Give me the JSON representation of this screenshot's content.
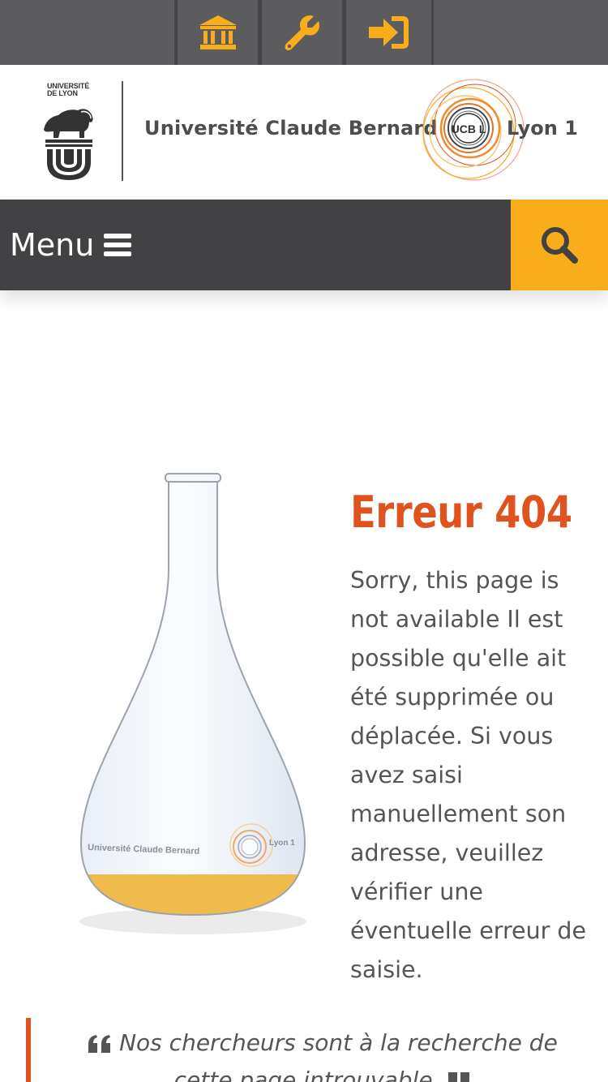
{
  "topbar": {
    "buttons": [
      {
        "icon": "institution-icon",
        "color": "#f9ad1b"
      },
      {
        "icon": "wrench-icon",
        "color": "#f9ad1b"
      },
      {
        "icon": "sign-in-icon",
        "color": "#f9ad1b"
      }
    ]
  },
  "header": {
    "ul_logo_text": "UNIVERSITÉ DE LYON",
    "ucbl_name": "Université Claude Bernard",
    "ucbl_city": "Lyon 1",
    "ring_monogram": "UCB L"
  },
  "menubar": {
    "menu_label": "Menu",
    "search_icon": "search-icon",
    "accent": "#f9ad1b"
  },
  "error": {
    "title": "Erreur 404",
    "message": "Sorry, this page is not available Il est possible qu'elle ait été supprimée ou déplacée. Si vous avez saisi manuellement son adresse, veuillez vérifier une éventuelle erreur de saisie.",
    "title_color": "#e0531e"
  },
  "flask": {
    "label": "Université Claude Bernard",
    "label_city": "Lyon 1",
    "liquid_color": "#f0bb4d"
  },
  "quote": {
    "text": "Nos chercheurs sont à la recherche de cette page introuvable."
  }
}
